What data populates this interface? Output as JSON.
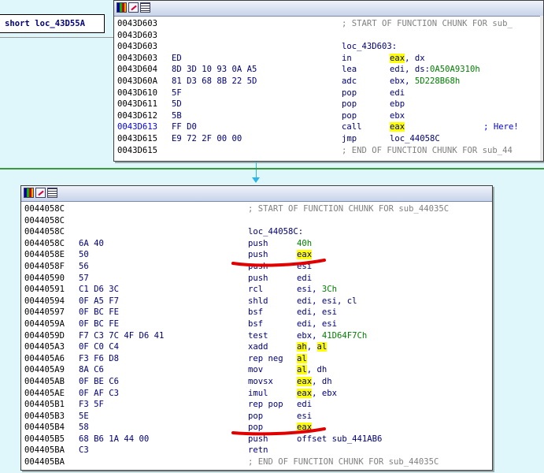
{
  "side": {
    "label": "short loc_43D55A"
  },
  "top_window": {
    "lines": [
      {
        "addr": "0043D603",
        "bytes": "",
        "mn": "",
        "op": "; START OF FUNCTION CHUNK FOR sub_",
        "type": "comment"
      },
      {
        "addr": "0043D603",
        "bytes": "",
        "mn": "",
        "op": "",
        "type": "blank"
      },
      {
        "addr": "0043D603",
        "bytes": "",
        "mn": "loc_43D603:",
        "op": "",
        "type": "label"
      },
      {
        "addr": "0043D603",
        "bytes": "ED",
        "mn": "in",
        "op_hl": "eax",
        "op_rest": ", dx",
        "type": "instr"
      },
      {
        "addr": "0043D604",
        "bytes": "8D 3D 10 93 0A A5",
        "mn": "lea",
        "op_plain": "edi, ds:",
        "op_num": "0A50A9310h",
        "type": "instr2"
      },
      {
        "addr": "0043D60A",
        "bytes": "81 D3 68 8B 22 5D",
        "mn": "adc",
        "op_plain": "ebx, ",
        "op_num": "5D228B68h",
        "type": "instr2"
      },
      {
        "addr": "0043D610",
        "bytes": "5F",
        "mn": "pop",
        "op": "edi",
        "type": "instr"
      },
      {
        "addr": "0043D611",
        "bytes": "5D",
        "mn": "pop",
        "op": "ebp",
        "type": "instr"
      },
      {
        "addr": "0043D612",
        "bytes": "5B",
        "mn": "pop",
        "op": "ebx",
        "type": "instr"
      },
      {
        "addr": "0043D613",
        "bytes": "FF D0",
        "mn": "call",
        "op_hl": "eax",
        "op_rest": "",
        "comment": "; Here!",
        "type": "instr",
        "addr_blue": true
      },
      {
        "addr": "0043D615",
        "bytes": "E9 72 2F 00 00",
        "mn": "jmp",
        "op": "loc_44058C",
        "type": "instr"
      },
      {
        "addr": "0043D615",
        "bytes": "",
        "mn": "",
        "op": "; END OF FUNCTION CHUNK FOR sub_44",
        "type": "comment"
      }
    ]
  },
  "bottom_window": {
    "lines": [
      {
        "addr": "0044058C",
        "bytes": "",
        "mn": "",
        "op": "; START OF FUNCTION CHUNK FOR sub_44035C",
        "type": "comment"
      },
      {
        "addr": "0044058C",
        "bytes": "",
        "mn": "",
        "op": "",
        "type": "blank"
      },
      {
        "addr": "0044058C",
        "bytes": "",
        "mn": "loc_44058C:",
        "op": "",
        "type": "label"
      },
      {
        "addr": "0044058C",
        "bytes": "6A 40",
        "mn": "push",
        "op_num_only": "40h",
        "type": "instr"
      },
      {
        "addr": "0044058E",
        "bytes": "50",
        "mn": "push",
        "op_hl": "eax",
        "op_rest": "",
        "type": "instr"
      },
      {
        "addr": "0044058F",
        "bytes": "56",
        "mn": "push",
        "op": "esi",
        "type": "instr",
        "obscured": true
      },
      {
        "addr": "00440590",
        "bytes": "57",
        "mn": "push",
        "op": "edi",
        "type": "instr"
      },
      {
        "addr": "00440591",
        "bytes": "C1 D6 3C",
        "mn": "rcl",
        "op_plain": "esi, ",
        "op_num": "3Ch",
        "type": "instr2"
      },
      {
        "addr": "00440594",
        "bytes": "0F A5 F7",
        "mn": "shld",
        "op": "edi, esi, cl",
        "type": "instr"
      },
      {
        "addr": "00440597",
        "bytes": "0F BC FE",
        "mn": "bsf",
        "op": "edi, esi",
        "type": "instr"
      },
      {
        "addr": "0044059A",
        "bytes": "0F BC FE",
        "mn": "bsf",
        "op": "edi, esi",
        "type": "instr"
      },
      {
        "addr": "0044059D",
        "bytes": "F7 C3 7C 4F D6 41",
        "mn": "test",
        "op_plain": "ebx, ",
        "op_num": "41D64F7Ch",
        "type": "instr2"
      },
      {
        "addr": "004405A3",
        "bytes": "0F C0 C4",
        "mn": "xadd",
        "op_hl": "ah",
        "op_mid": ", ",
        "op_hl2": "al",
        "type": "instr3"
      },
      {
        "addr": "004405A6",
        "bytes": "F3 F6 D8",
        "mn": "rep neg",
        "op_hl": "al",
        "op_rest": "",
        "type": "instr"
      },
      {
        "addr": "004405A9",
        "bytes": "8A C6",
        "mn": "mov",
        "op_hl": "al",
        "op_rest": ", dh",
        "type": "instr"
      },
      {
        "addr": "004405AB",
        "bytes": "0F BE C6",
        "mn": "movsx",
        "op_hl": "eax",
        "op_rest": ", dh",
        "type": "instr"
      },
      {
        "addr": "004405AE",
        "bytes": "0F AF C3",
        "mn": "imul",
        "op_hl": "eax",
        "op_rest": ", ebx",
        "type": "instr"
      },
      {
        "addr": "004405B1",
        "bytes": "F3 5F",
        "mn": "rep pop",
        "op": "edi",
        "type": "instr"
      },
      {
        "addr": "004405B3",
        "bytes": "5E",
        "mn": "pop",
        "op": "esi",
        "type": "instr"
      },
      {
        "addr": "004405B4",
        "bytes": "58",
        "mn": "pop",
        "op_hl": "eax",
        "op_rest": "",
        "type": "instr"
      },
      {
        "addr": "004405B5",
        "bytes": "68 B6 1A 44 00",
        "mn": "push",
        "op": "offset sub_441AB6",
        "type": "instr"
      },
      {
        "addr": "004405BA",
        "bytes": "C3",
        "mn": "retn",
        "op": "",
        "type": "instr"
      },
      {
        "addr": "004405BA",
        "bytes": "",
        "mn": "",
        "op": "; END OF FUNCTION CHUNK FOR sub_44035C",
        "type": "comment"
      }
    ]
  },
  "colors": {
    "highlight": "#ffff00",
    "number": "#008000",
    "code": "#000080",
    "comment": "#808080",
    "marker": "#e00000",
    "background": "#dff6fb"
  },
  "icons": [
    "graph-view-icon",
    "edit-icon",
    "text-view-icon"
  ]
}
